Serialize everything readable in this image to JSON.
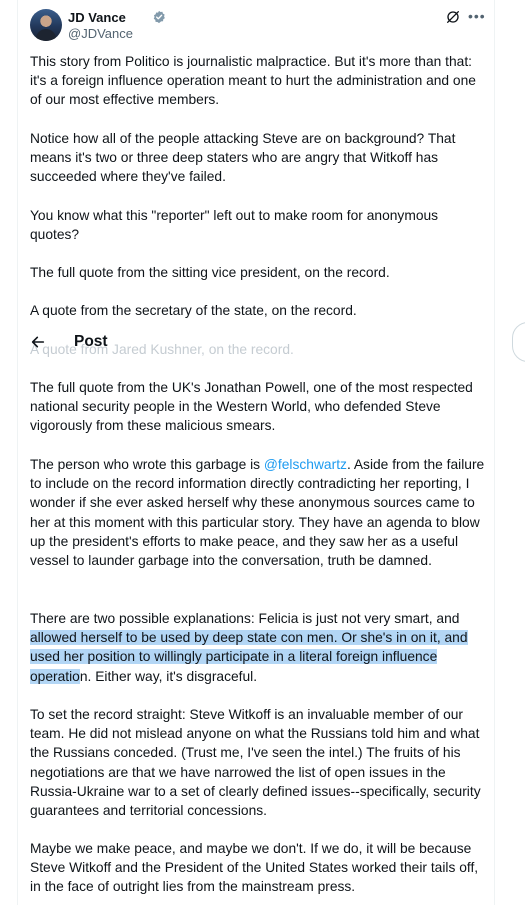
{
  "author": {
    "name": "JD Vance",
    "handle": "@JDVance",
    "verified": true
  },
  "icons": {
    "verified": "verified-badge-icon",
    "grok": "grok-icon",
    "more": "more-icon",
    "back": "back-arrow-icon"
  },
  "colors": {
    "accent": "#1d9bf0",
    "text": "#0f1419",
    "secondary": "#536471",
    "highlight": "#b3d6f5"
  },
  "overlay": {
    "title": "Post"
  },
  "tweet": {
    "p1": "This story from Politico is journalistic malpractice. But it's more than that: it's a foreign influence operation meant to hurt the administration and one of our most effective members.",
    "p2": "Notice how all of the people attacking Steve are on background? That means it's two or three deep staters who are angry that Witkoff has succeeded where they've failed.",
    "p3": "You know what this \"reporter\" left out to make room for anonymous quotes?",
    "p4": "The full quote from the sitting vice president, on the record.",
    "p5": "A quote from the secretary of the state, on the record.",
    "p6": "A quote from Jared Kushner, on the record.",
    "p7": "The full quote from the UK's Jonathan Powell, one of the most respected national security people in the Western World, who defended Steve vigorously from these malicious smears.",
    "p8_a": "The person who wrote this garbage is ",
    "p8_mention": "@felschwartz",
    "p8_b": ". Aside from the failure to include on the record information directly contradicting her reporting, I wonder if she ever asked herself why these anonymous sources came to her at this moment with this particular story. They have an agenda to blow up the president's efforts to make peace, and they saw her as a useful vessel to launder garbage into the conversation, truth be damned.",
    "p9_a": "There are two possible explanations: Felicia is just not very smart, and ",
    "p9_highlight": "allowed herself to be used by deep state con men. Or she's in on it, and used her position to willingly participate in a literal foreign influence operatio",
    "p9_b": "n. Either way, it's disgraceful.",
    "p10": "To set the record straight: Steve Witkoff is an invaluable member of our team. He did not mislead anyone on what the Russians told him and what the Russians conceded. (Trust me, I've seen the intel.) The fruits of his negotiations are that we have narrowed the list of open issues in the Russia-Ukraine war to a set of clearly defined issues--specifically, security guarantees and territorial concessions.",
    "p11": "Maybe we make peace, and maybe we don't. If we do, it will be because Steve Witkoff and the President of the United States worked their tails off, in the face of outright lies from the mainstream press."
  }
}
